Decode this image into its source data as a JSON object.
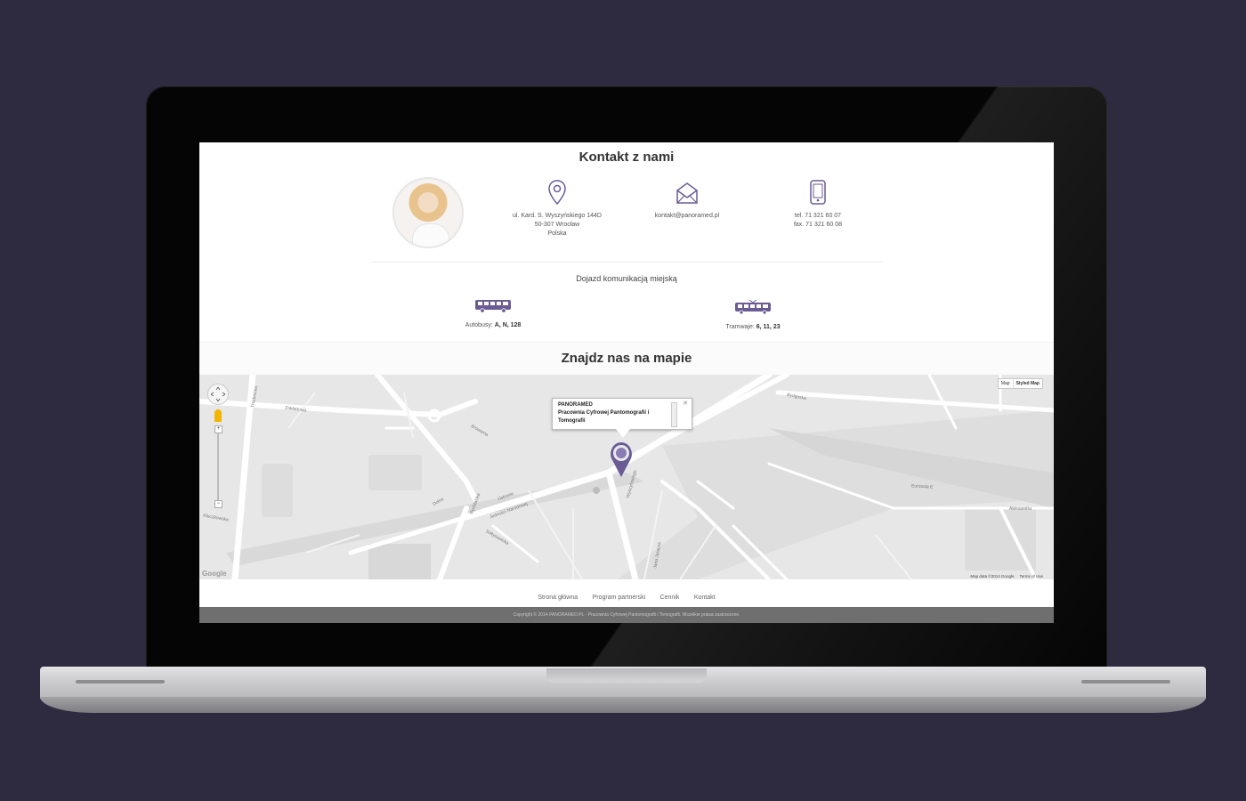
{
  "page": {
    "contact_title": "Kontakt z nami",
    "address": [
      "ul. Kard. S. Wyszyńskiego 144D",
      "50-307 Wrocław",
      "Polska"
    ],
    "email": "kontakt@panoramed.pl",
    "phone": [
      "tel. 71 321 60 07",
      "fax. 71 321 60 08"
    ],
    "transit_title": "Dojazd komunikacją miejską",
    "bus_label": "Autobusy:",
    "bus_lines": "A, N, 128",
    "tram_label": "Tramwaje:",
    "tram_lines": "6, 11, 23",
    "map_title": "Znajdz nas na mapie",
    "accent_color": "#6b5b95"
  },
  "map": {
    "type_buttons": [
      "Map",
      "Styled Map"
    ],
    "infowindow": [
      "PANORAMED",
      "Pracownia Cyfrowej Pantomografii i",
      "Tomografii"
    ],
    "footer_text": [
      "Map data ©2014 Google",
      "Terms of Use"
    ],
    "logo": "Google",
    "streets": [
      "Zakładowa",
      "Trzebnicka",
      "Bydgoska",
      "Browarna",
      "Jedności Narodowej",
      "Wyszyńskiego",
      "Ustronie",
      "Dolna",
      "Kleczkowska",
      "Rychtalska",
      "Sołtysowicka",
      "Eurosola E",
      "Aleksandra",
      "Jana Jaracza"
    ]
  },
  "footer": {
    "nav": [
      "Strona główna",
      "Program partnerski",
      "Cennik",
      "Kontakt"
    ],
    "copyright": "Copyright © 2014 PANORAMED.PL - Pracownia Cyfrowej Pantomografii i Tomografii. Wszelkie prawa zastrzeżone."
  }
}
